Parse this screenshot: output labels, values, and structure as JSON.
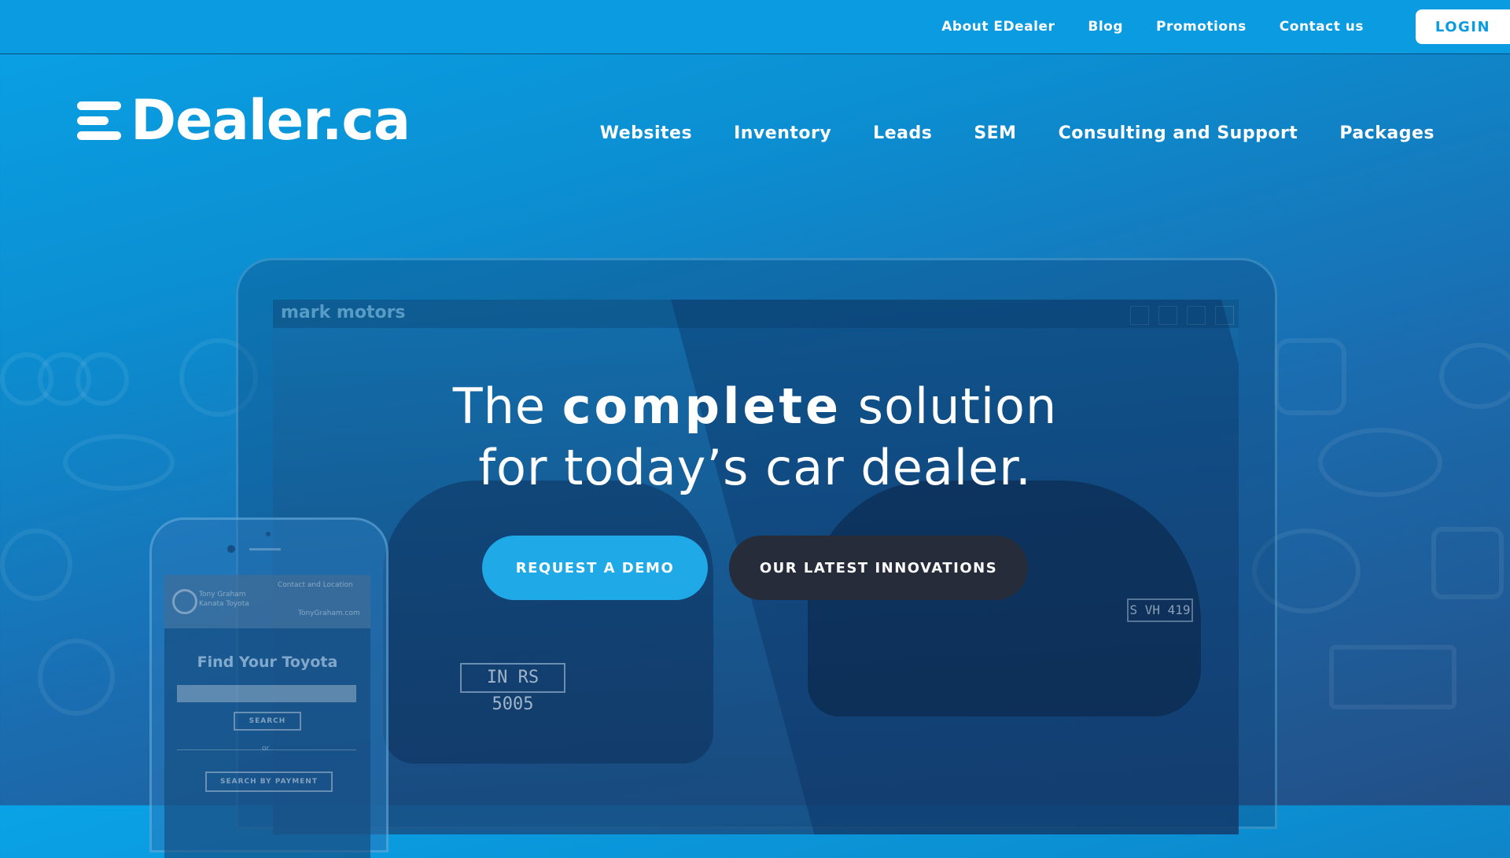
{
  "topnav": {
    "items": [
      "About EDealer",
      "Blog",
      "Promotions",
      "Contact us"
    ],
    "login": "LOGIN"
  },
  "logo": {
    "text": "Dealer.ca"
  },
  "mainnav": {
    "items": [
      "Websites",
      "Inventory",
      "Leads",
      "SEM",
      "Consulting and Support",
      "Packages"
    ]
  },
  "hero": {
    "line1_pre": "The ",
    "line1_bold": "complete",
    "line1_post": " solution",
    "line2": "for today’s car dealer."
  },
  "buttons": {
    "demo": "REQUEST A DEMO",
    "innovations": "OUR LATEST INNOVATIONS"
  },
  "mockup": {
    "site_name": "mark motors",
    "plate1": "IN RS 5005",
    "plate2": "S VH 419",
    "phone": {
      "dealer_line1": "Tony Graham",
      "dealer_line2": "Kanata Toyota",
      "contact": "Contact and Location",
      "site": "TonyGraham.com",
      "find": "Find Your Toyota",
      "search": "SEARCH",
      "or": "or",
      "search_payment": "SEARCH BY PAYMENT"
    }
  },
  "colors": {
    "primary": "#0a9be0",
    "demo_button": "#1fa9e6",
    "innovations_button": "#262c3a"
  }
}
